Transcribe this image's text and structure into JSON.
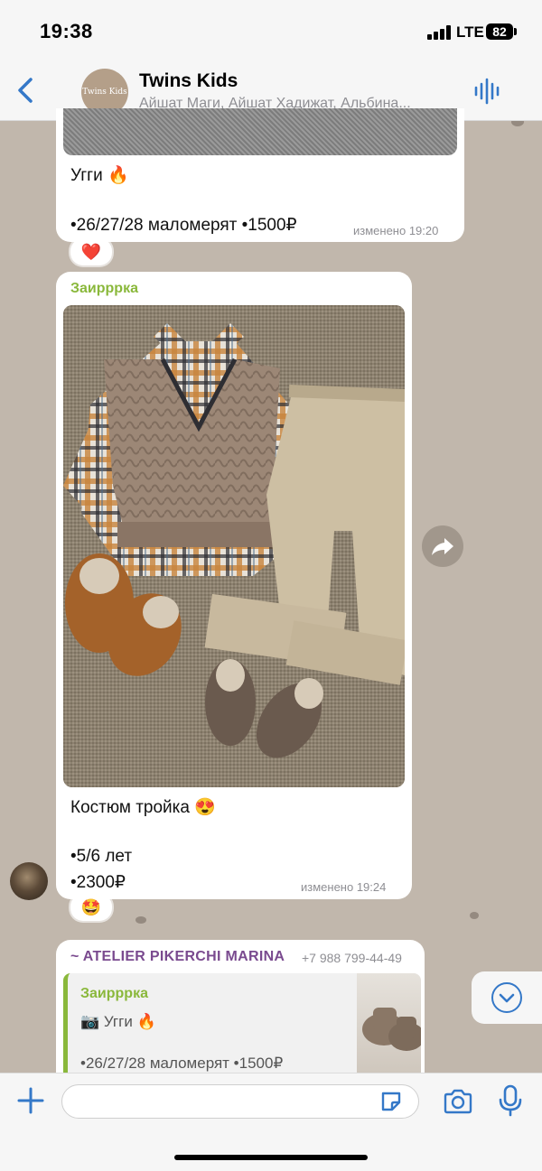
{
  "status_bar": {
    "time": "19:38",
    "network": "LTE",
    "battery": "82"
  },
  "header": {
    "back_icon": "chevron-left-icon",
    "avatar_text": "Twins Kids",
    "title": "Twins Kids",
    "subtitle": "Айшат Маги, Айшат Хадижат, Альбина...",
    "voice_icon": "audio-wave-icon",
    "accent_color": "#3478c8"
  },
  "messages": [
    {
      "text_line1": "Угги 🔥",
      "text_line2": "•26/27/28 маломерят •1500₽",
      "edited": "изменено 19:20",
      "reaction": "❤️"
    },
    {
      "sender": "Заирррка",
      "sender_color": "#8ab83b",
      "caption_line1": "Костюм тройка 😍",
      "caption_line2": "•5/6 лет",
      "caption_line3": "•2300₽",
      "edited": "изменено 19:24",
      "reaction": "🤩"
    },
    {
      "forwarded_from": "~ ATELIER PIKERCHI MARINA",
      "phone": "+7 988 799-44-49",
      "quote_sender": "Заирррка",
      "quote_line1": "📷 Угги 🔥",
      "quote_line2": "•26/27/28 маломерят •1500₽"
    }
  ],
  "input_bar": {
    "placeholder": "",
    "icons": [
      "plus-icon",
      "sticker-icon",
      "camera-icon",
      "microphone-icon"
    ]
  }
}
